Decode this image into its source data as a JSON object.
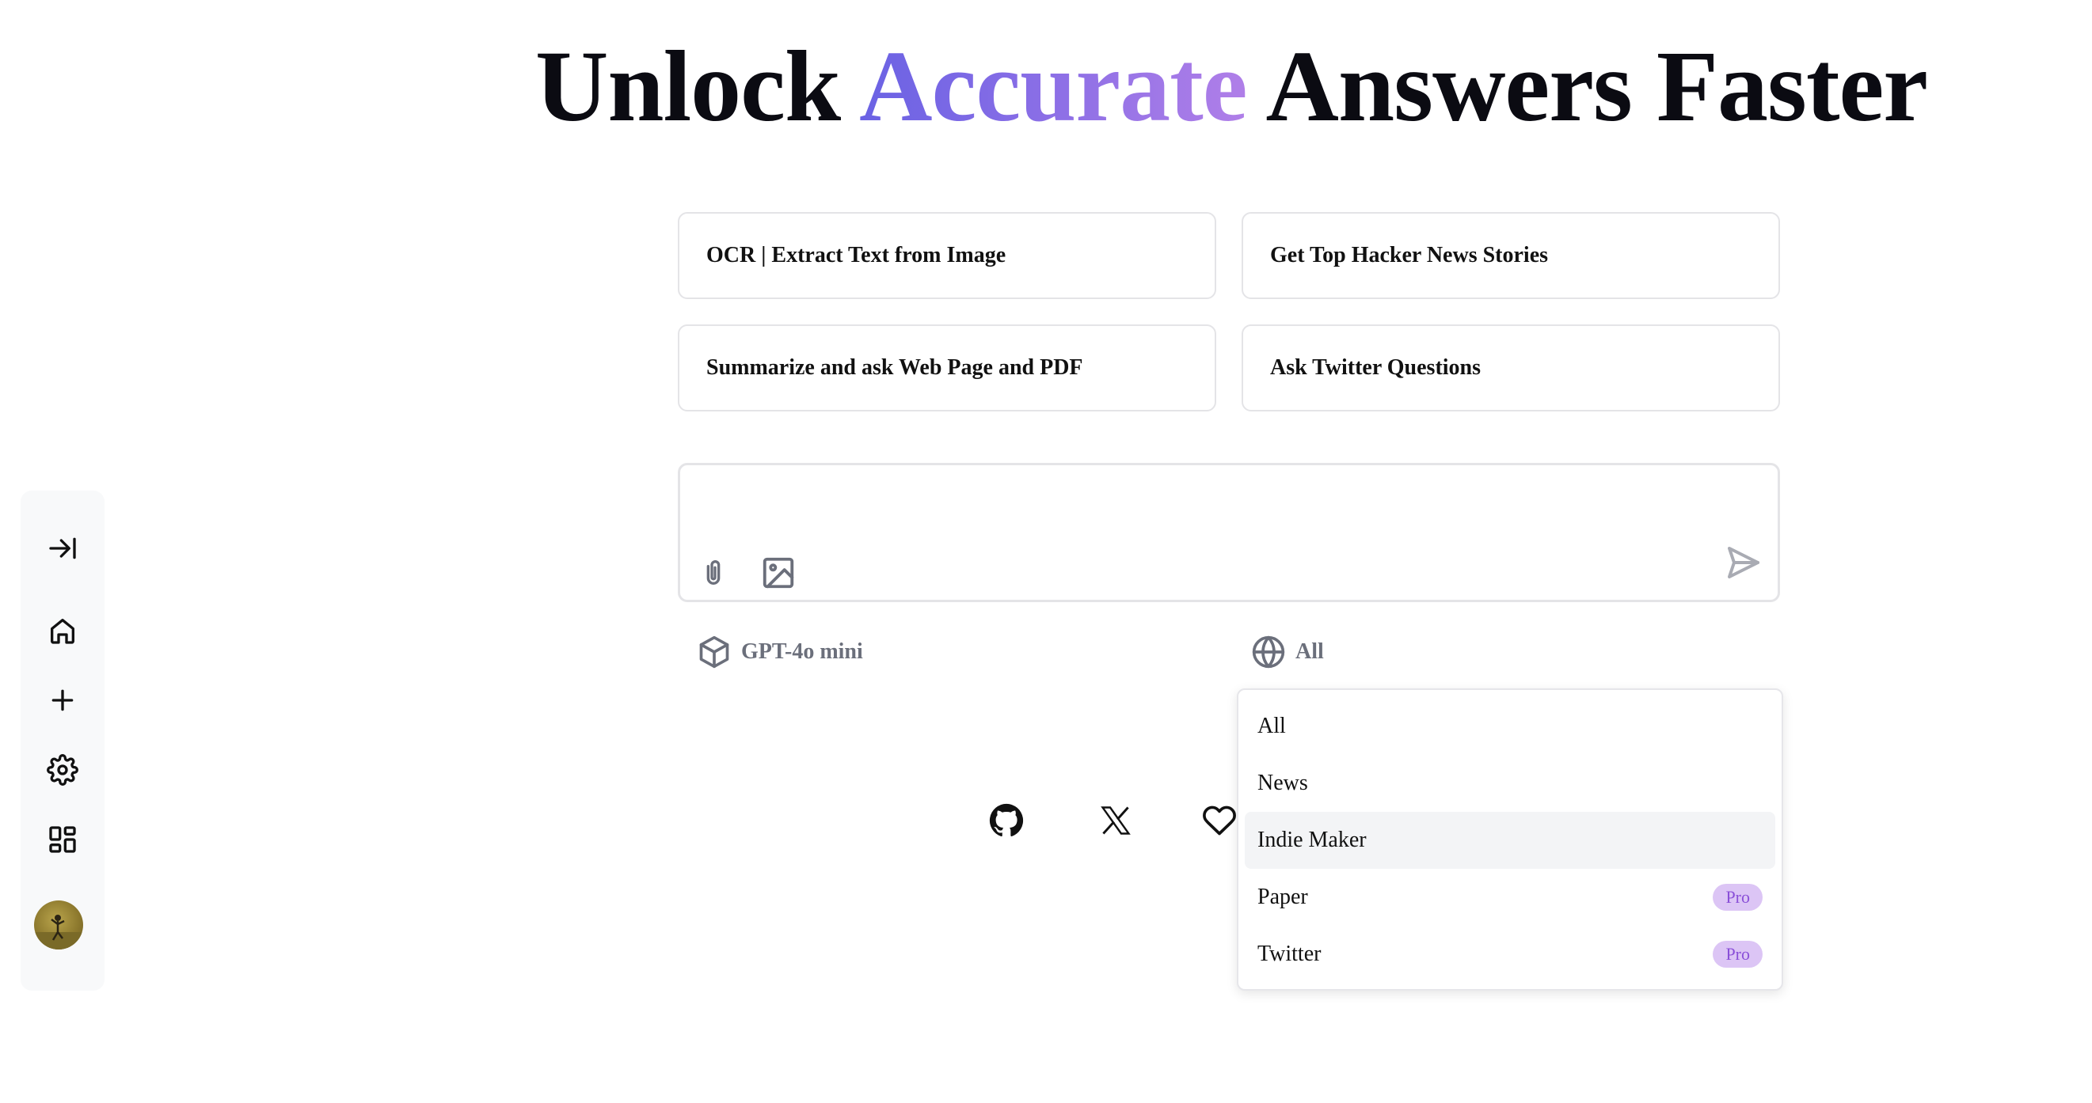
{
  "headline": {
    "part1": "Unlock ",
    "accent": "Accurate",
    "part2": " Answers Faster"
  },
  "suggestions": [
    "OCR | Extract Text from Image",
    "Get Top Hacker News Stories",
    "Summarize and ask Web Page and PDF",
    "Ask Twitter Questions"
  ],
  "input": {
    "value": "",
    "placeholder": ""
  },
  "model_selector": {
    "label": "GPT-4o mini",
    "icon": "cube-icon"
  },
  "source_selector": {
    "label": "All",
    "icon": "globe-icon"
  },
  "dropdown": {
    "items": [
      {
        "label": "All",
        "badge": ""
      },
      {
        "label": "News",
        "badge": ""
      },
      {
        "label": "Indie Maker",
        "badge": ""
      },
      {
        "label": "Paper",
        "badge": "Pro"
      },
      {
        "label": "Twitter",
        "badge": "Pro"
      }
    ],
    "highlighted": "Indie Maker"
  },
  "sidebar": {
    "icons": [
      "expand-sidebar-icon",
      "home-icon",
      "plus-icon",
      "gear-icon",
      "apps-icon",
      "avatar"
    ]
  },
  "social": {
    "icons": [
      "github-icon",
      "x-icon",
      "heart-icon"
    ]
  },
  "colors": {
    "accent_start": "#6a62e4",
    "accent_end": "#b07fe8",
    "pro_badge_bg": "#dcc5f5",
    "pro_badge_text": "#8a4fd8"
  }
}
